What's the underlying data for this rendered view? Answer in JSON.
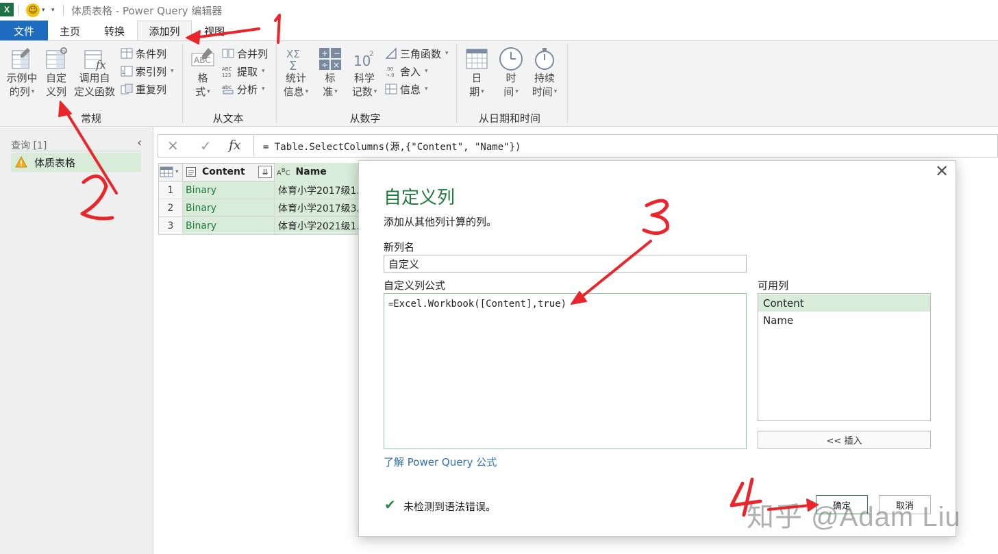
{
  "window": {
    "title": "体质表格 - Power Query 编辑器",
    "app_icon": "excel-icon",
    "quick_access_icon": "smiley-icon"
  },
  "tabs": [
    {
      "label": "文件",
      "active": false
    },
    {
      "label": "主页",
      "active": false
    },
    {
      "label": "转换",
      "active": false
    },
    {
      "label": "添加列",
      "active": true
    },
    {
      "label": "视图",
      "active": false
    }
  ],
  "ribbon": {
    "groups": {
      "general": "常规",
      "from_text": "从文本",
      "from_number": "从数字",
      "from_datetime": "从日期和时间"
    },
    "buttons": {
      "col_from_examples": [
        "示例中",
        "的列"
      ],
      "custom_column": [
        "自定",
        "义列"
      ],
      "invoke_custom_fn": [
        "调用自",
        "定义函数"
      ],
      "conditional_col": "条件列",
      "index_col": "索引列",
      "duplicate_col": "重复列",
      "format": [
        "格",
        "式"
      ],
      "merge_cols": "合并列",
      "extract": "提取",
      "parse": "分析",
      "statistics": [
        "统计",
        "信息"
      ],
      "standard": [
        "标",
        "准"
      ],
      "scientific": [
        "科学",
        "记数"
      ],
      "trigonometry": "三角函数",
      "rounding": "舍入",
      "information": "信息",
      "date": [
        "日",
        "期"
      ],
      "time": [
        "时",
        "间"
      ],
      "duration": [
        "持续",
        "时间"
      ]
    }
  },
  "queries": {
    "header": "查询 [1]",
    "items": [
      "体质表格"
    ]
  },
  "formula_bar": {
    "text": "= Table.SelectColumns(源,{\"Content\", \"Name\"})"
  },
  "table": {
    "columns": [
      "Content",
      "Name"
    ],
    "rows": [
      {
        "n": "1",
        "content": "Binary",
        "name": "体育小学2017级1."
      },
      {
        "n": "2",
        "content": "Binary",
        "name": "体育小学2017级3."
      },
      {
        "n": "3",
        "content": "Binary",
        "name": "体育小学2021级1."
      }
    ]
  },
  "dialog": {
    "title": "自定义列",
    "subtitle": "添加从其他列计算的列。",
    "new_col_label": "新列名",
    "new_col_value": "自定义",
    "formula_label": "自定义列公式",
    "formula_prefix": "=",
    "formula_value": "Excel.Workbook([Content],true)",
    "available_label": "可用列",
    "available_columns": [
      "Content",
      "Name"
    ],
    "selected_column": "Content",
    "insert_button": "<< 插入",
    "learn_link": "了解 Power Query 公式",
    "status": "未检测到语法错误。",
    "ok_button": "确定",
    "cancel_button": "取消"
  },
  "annotations": [
    "1",
    "2",
    "3",
    "4"
  ],
  "watermark": "知乎 @Adam Liu",
  "colors": {
    "accent_green": "#217a3c",
    "selected_green": "#d9ecd9",
    "file_tab_blue": "#1e6bbf",
    "annotation_red": "#e8262b"
  }
}
